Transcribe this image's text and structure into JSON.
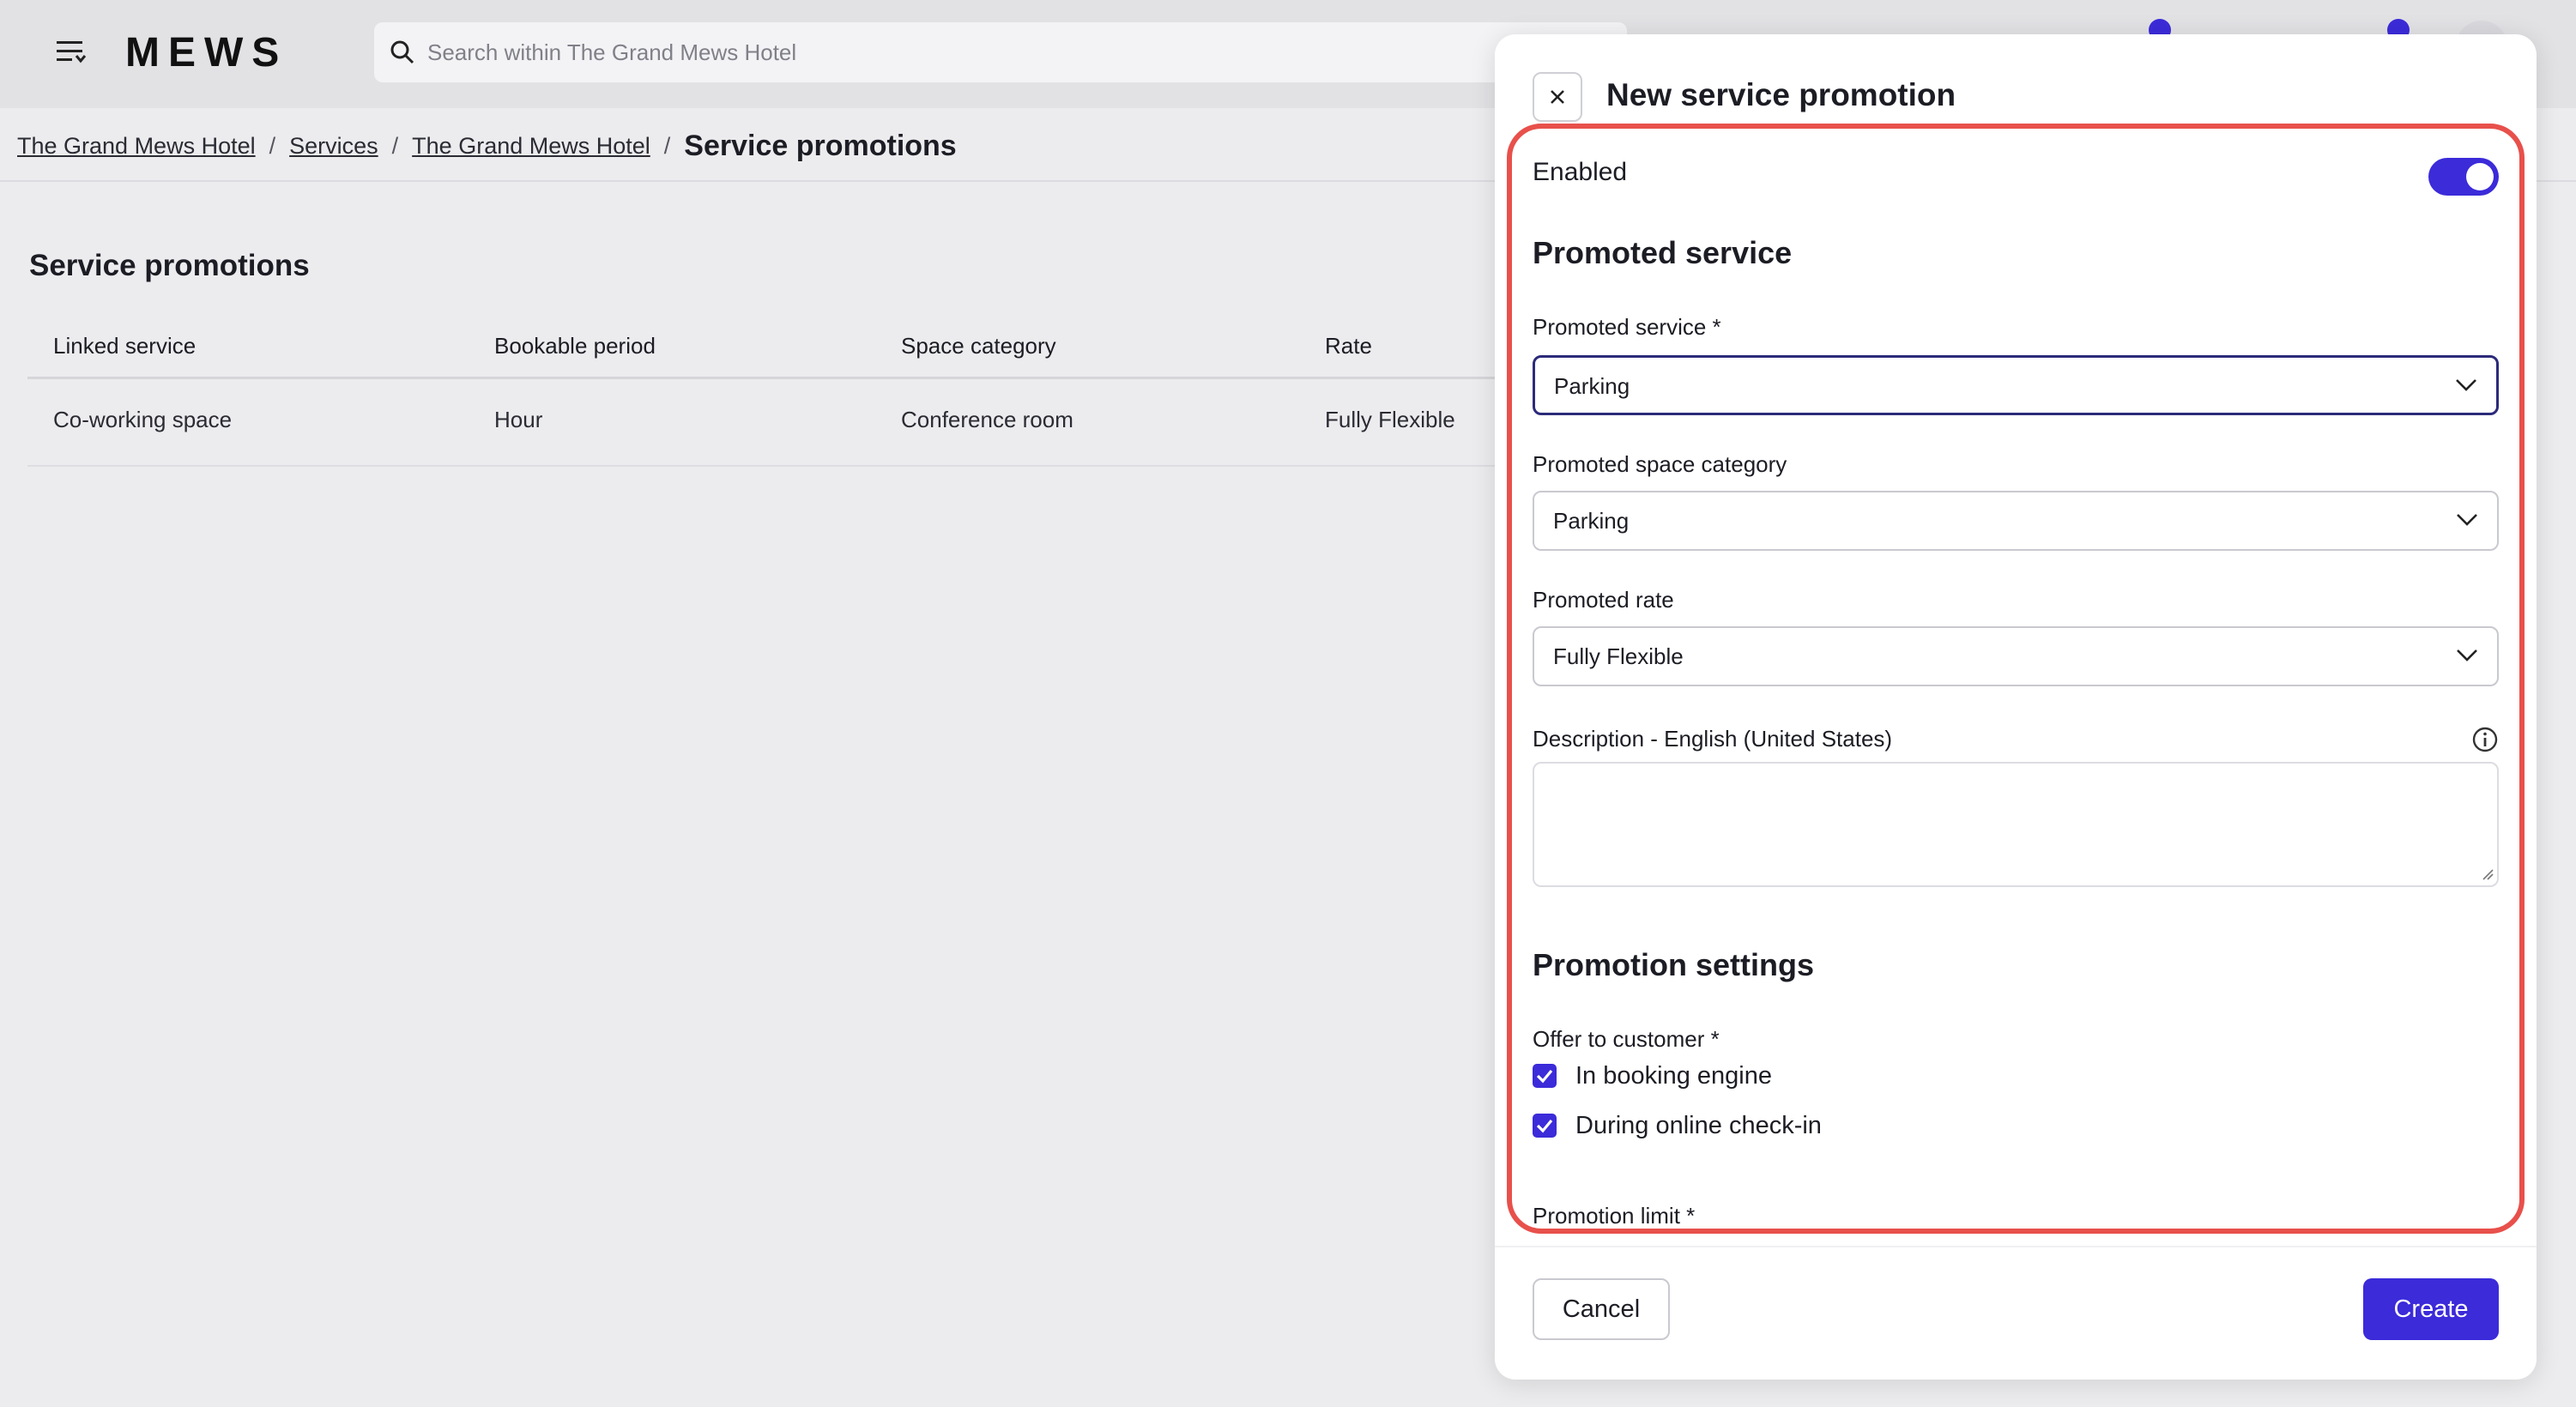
{
  "header": {
    "logo": "MEWS",
    "search_placeholder": "Search within The Grand Mews Hotel"
  },
  "breadcrumb": {
    "items": [
      "The Grand Mews Hotel",
      "Services",
      "The Grand Mews Hotel"
    ],
    "separator": "/",
    "current": "Service promotions",
    "right_glyph": ")"
  },
  "main": {
    "title": "Service promotions",
    "columns": [
      "Linked service",
      "Bookable period",
      "Space category",
      "Rate"
    ],
    "rows": [
      [
        "Co-working space",
        "Hour",
        "Conference room",
        "Fully Flexible"
      ]
    ]
  },
  "drawer": {
    "title": "New service promotion",
    "enabled_label": "Enabled",
    "enabled": true,
    "section_promoted": "Promoted service",
    "promoted_service_label": "Promoted service *",
    "promoted_service_value": "Parking",
    "promoted_space_label": "Promoted space category",
    "promoted_space_value": "Parking",
    "promoted_rate_label": "Promoted rate",
    "promoted_rate_value": "Fully Flexible",
    "description_label": "Description - English (United States)",
    "description_value": "",
    "section_settings": "Promotion settings",
    "offer_label": "Offer to customer *",
    "offer_options": [
      {
        "label": "In booking engine",
        "checked": true
      },
      {
        "label": "During online check-in",
        "checked": true
      }
    ],
    "promotion_limit_label": "Promotion limit *",
    "cancel_label": "Cancel",
    "create_label": "Create"
  },
  "colors": {
    "accent": "#3b2bd9",
    "highlight": "#e8504b",
    "topbar": "#e2e2e5",
    "background": "#ececee"
  },
  "icons": [
    "menu-icon",
    "search-icon",
    "close-icon",
    "chevron-down-icon",
    "info-icon",
    "check-icon"
  ]
}
